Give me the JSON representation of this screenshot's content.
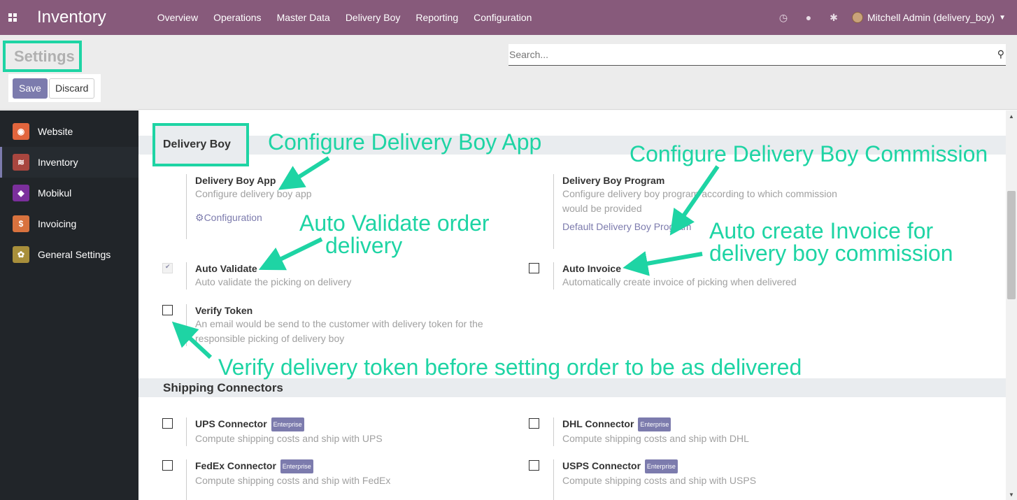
{
  "navbar": {
    "app_name": "Inventory",
    "menu": [
      "Overview",
      "Operations",
      "Master Data",
      "Delivery Boy",
      "Reporting",
      "Configuration"
    ],
    "user": "Mitchell Admin (delivery_boy)"
  },
  "control": {
    "title": "Settings",
    "save_label": "Save",
    "discard_label": "Discard",
    "search_placeholder": "Search..."
  },
  "sidebar": {
    "items": [
      {
        "label": "Website",
        "color": "#e1653d"
      },
      {
        "label": "Inventory",
        "color": "#a8463f"
      },
      {
        "label": "Mobikul",
        "color": "#7b2f9c"
      },
      {
        "label": "Invoicing",
        "color": "#d8723e"
      },
      {
        "label": "General Settings",
        "color": "#a88f3b"
      }
    ]
  },
  "delivery_boy": {
    "section_title": "Delivery Boy",
    "app": {
      "title": "Delivery Boy App",
      "desc": "Configure delivery boy app",
      "link": "Configuration"
    },
    "program": {
      "title": "Delivery Boy Program",
      "desc": "Configure delivery boy program according to which commission would be provided",
      "link": "Default Delivery Boy Program"
    },
    "auto_validate": {
      "title": "Auto Validate",
      "desc": "Auto validate the picking on delivery",
      "checked": true
    },
    "auto_invoice": {
      "title": "Auto Invoice",
      "desc": "Automatically create invoice of picking when delivered",
      "checked": false
    },
    "verify_token": {
      "title": "Verify Token",
      "desc": "An email would be send to the customer with delivery token for the responsible picking of delivery boy",
      "checked": false
    }
  },
  "shipping": {
    "section_title": "Shipping Connectors",
    "badge": "Enterprise",
    "connectors": [
      {
        "title": "UPS Connector",
        "desc": "Compute shipping costs and ship with UPS"
      },
      {
        "title": "DHL Connector",
        "desc": "Compute shipping costs and ship with DHL"
      },
      {
        "title": "FedEx Connector",
        "desc": "Compute shipping costs and ship with FedEx"
      },
      {
        "title": "USPS Connector",
        "desc": "Compute shipping costs and ship with USPS"
      }
    ]
  },
  "annotations": {
    "app": "Configure Delivery Boy App",
    "commission": "Configure Delivery Boy Commission",
    "validate_line1": "Auto Validate order",
    "validate_line2": "delivery",
    "invoice_line1": "Auto create Invoice for",
    "invoice_line2": "delivery boy commission",
    "token": "Verify delivery token before setting order to be as delivered"
  },
  "colors": {
    "navbar": "#875a7b",
    "primary": "#7c7bad",
    "annotation": "#1ed4a4",
    "sidebar": "#212529"
  }
}
